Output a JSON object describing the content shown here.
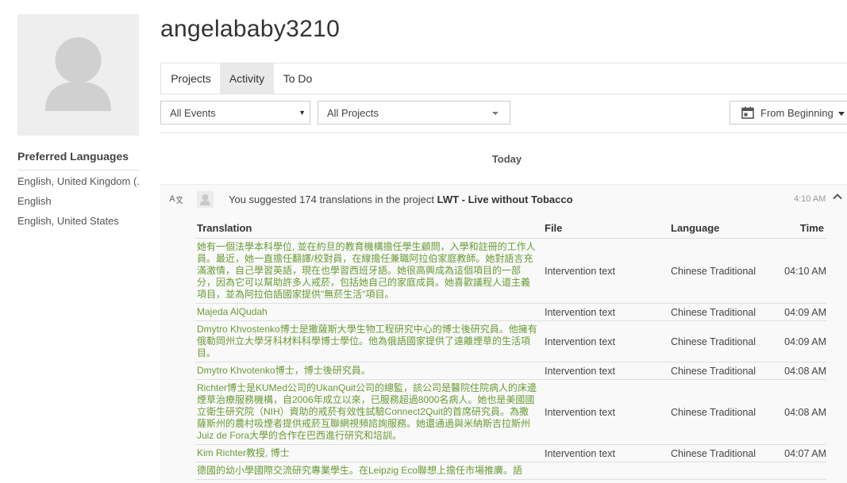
{
  "profile": {
    "username": "angelababy3210",
    "preferred_languages_title": "Preferred Languages",
    "languages": [
      "English, United Kingdom (...",
      "English",
      "English, United States"
    ]
  },
  "tabs": [
    {
      "label": "Projects",
      "active": false
    },
    {
      "label": "Activity",
      "active": true
    },
    {
      "label": "To Do",
      "active": false
    }
  ],
  "filters": {
    "events": "All Events",
    "projects": "All Projects",
    "date": "From Beginning"
  },
  "day_label": "Today",
  "activity": {
    "text_prefix": "You suggested 174 translations in the project ",
    "project": "LWT - Live without Tobacco",
    "time": "4:10 AM",
    "columns": {
      "translation": "Translation",
      "file": "File",
      "language": "Language",
      "time": "Time"
    },
    "rows": [
      {
        "translation": "她有一個法學本科學位, 並在約旦的教育機構擔任學生顧問，入學和註冊的工作人員。最近，她一直擔任翻譯/校對員，在線擔任兼職阿拉伯家庭教師。她對語言充滿激情，自己學習英語，現在也學習西班牙語。她很高興成為這個項目的一部分，因為它可以幫助許多人戒菸，包括她自己的家庭成員。她喜歡議程人道主義項目，並為阿拉伯語國家提供\"無菸生活\"項目。",
        "file": "Intervention text",
        "language": "Chinese Traditional",
        "time": "04:10 AM"
      },
      {
        "translation": "Majeda AlQudah",
        "file": "Intervention text",
        "language": "Chinese Traditional",
        "time": "04:09 AM"
      },
      {
        "translation": "Dmytro Khvostenko博士是撒薩斯大學生物工程研究中心的博士後研究員。他擁有俄勒岡州立大學牙科材料科學博士學位。他為俄語國家提供了遠離煙草的生活項目。",
        "file": "Intervention text",
        "language": "Chinese Traditional",
        "time": "04:09 AM"
      },
      {
        "translation": "Dmytro Khvotenko博士，博士後研究員。",
        "file": "Intervention text",
        "language": "Chinese Traditional",
        "time": "04:08 AM"
      },
      {
        "translation": "Richter博士是KUMed公司的UkanQuit公司的總監，該公司是醫院住院病人的床邊煙草治療服務機構，自2006年成立以來，已服務超過8000名病人。她也是美國國立衛生研究院（NIH）資助的戒菸有效性試驗Connect2Quit的首席研究員。為撒薩斯州的農村吸煙者提供戒菸互聯網視頻諮詢服務。她還通過與米納斯吉拉斯州Juiz de Fora大學的合作在巴西進行研究和培訓。",
        "file": "Intervention text",
        "language": "Chinese Traditional",
        "time": "04:08 AM"
      },
      {
        "translation": "Kim Richter教授, 博士",
        "file": "Intervention text",
        "language": "Chinese Traditional",
        "time": "04:07 AM"
      },
      {
        "translation": "德國的幼小學國際交流研究專業學生。在Leipzig Eco聯想上擔任市場推廣。語",
        "file": "",
        "language": "",
        "time": ""
      }
    ]
  }
}
